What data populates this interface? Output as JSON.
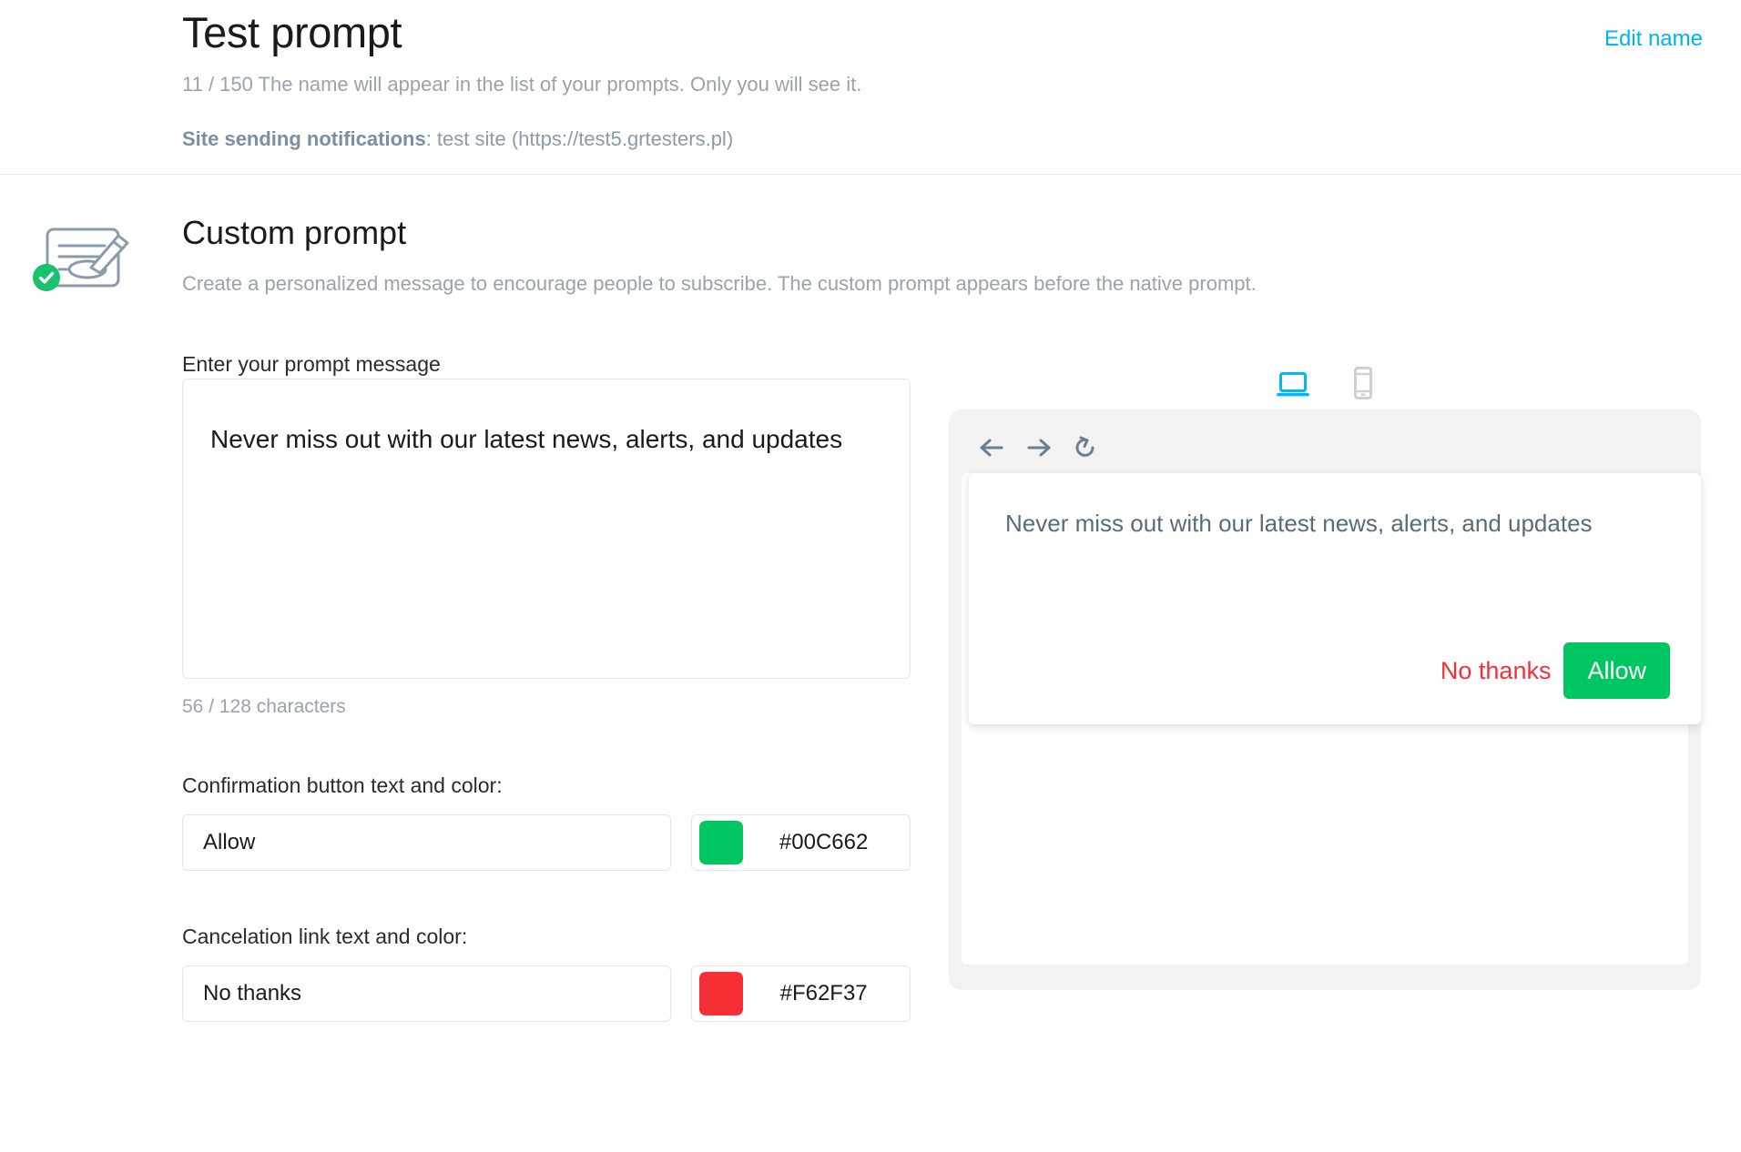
{
  "header": {
    "title": "Test prompt",
    "edit_name_label": "Edit name",
    "name_hint": "11 / 150 The name will appear in the list of your prompts. Only you will see it.",
    "site_label": "Site sending notifications",
    "site_value": ": test site (https://test5.grtesters.pl)"
  },
  "section": {
    "title": "Custom prompt",
    "description": "Create a personalized message to encourage people to subscribe. The custom prompt appears before the native prompt."
  },
  "form": {
    "message_label": "Enter your prompt message",
    "message_value": "Never miss out with our latest news, alerts, and updates",
    "message_placeholder": "Enter your prompt message",
    "char_count": "56 / 128 characters",
    "confirm": {
      "label": "Confirmation button text and color:",
      "text_value": "Allow",
      "text_placeholder": "Allow",
      "color_hex": "#00C662"
    },
    "cancel": {
      "label": "Cancelation link text and color:",
      "text_value": "No thanks",
      "text_placeholder": "No thanks",
      "color_hex": "#F62F37"
    }
  },
  "preview": {
    "devices": [
      {
        "name": "desktop",
        "icon": "laptop-icon",
        "active": true
      },
      {
        "name": "mobile",
        "icon": "mobile-icon",
        "active": false
      }
    ],
    "toolbar": [
      {
        "name": "back",
        "icon": "arrow-left-icon"
      },
      {
        "name": "forward",
        "icon": "arrow-right-icon"
      },
      {
        "name": "reload",
        "icon": "reload-icon"
      }
    ],
    "notification": {
      "message": "Never miss out with our latest news, alerts, and updates",
      "decline_label": "No thanks",
      "allow_label": "Allow"
    }
  },
  "colors": {
    "accent_cyan": "#00b3f0",
    "device_active": "#00b8f5",
    "device_inactive": "#cdd1d4",
    "allow_green": "#00C662",
    "decline_red": "#F62F37",
    "muted_text": "#9aa3ab",
    "slate_text": "#7b8fa3",
    "toolbar_icon": "#6b7f92"
  }
}
